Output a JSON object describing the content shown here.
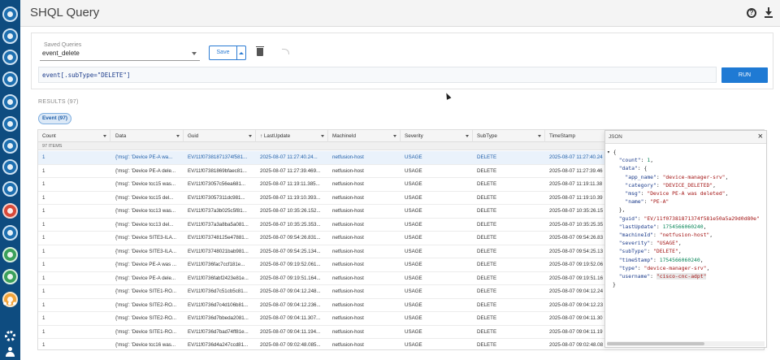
{
  "header": {
    "title": "SHQL Query"
  },
  "query_panel": {
    "saved_queries_label": "Saved Queries",
    "saved_query_value": "event_delete",
    "save_label": "Save",
    "query_text": "event[.subType=\"DELETE\"]",
    "run_label": "RUN"
  },
  "results": {
    "label": "RESULTS (97)",
    "tab_label": "Event (97)",
    "group_label": "97 ITEMS",
    "columns": [
      "Count",
      "Data",
      "Guid",
      "↑ LastUpdate",
      "MachineId",
      "Severity",
      "SubType",
      "TimeStamp"
    ],
    "rows": [
      [
        "1",
        "{'msg': 'Device PE-A wa...",
        "EV/11f07381871374f581...",
        "2025-08-07 11:27:40.24...",
        "netfusion-host",
        "USAGE",
        "DELETE",
        "2025-08-07 11:27:40.24"
      ],
      [
        "1",
        "{'msg': 'Device PE-A dele...",
        "EV/11f07381869bfaec81...",
        "2025-08-07 11:27:39.469...",
        "netfusion-host",
        "USAGE",
        "DELETE",
        "2025-08-07 11:27:39.46"
      ],
      [
        "1",
        "{'msg': 'Device tcc15 was...",
        "EV/11f073057c56ea681...",
        "2025-08-07 11:19:11.385...",
        "netfusion-host",
        "USAGE",
        "DELETE",
        "2025-08-07 11:19:11.38"
      ],
      [
        "1",
        "{'msg': 'Device tcc15 del...",
        "EV/11f073057311dc981...",
        "2025-08-07 11:19:10.393...",
        "netfusion-host",
        "USAGE",
        "DELETE",
        "2025-08-07 11:19:10.39"
      ],
      [
        "1",
        "{'msg': 'Device tcc13 was...",
        "EV/11f0737a3b025c5f81...",
        "2025-08-07 10:35:26.152...",
        "netfusion-host",
        "USAGE",
        "DELETE",
        "2025-08-07 10:35:26.15"
      ],
      [
        "1",
        "{'msg': 'Device tcc13 del...",
        "EV/11f0737a3a8ba5a081...",
        "2025-08-07 10:35:25.353...",
        "netfusion-host",
        "USAGE",
        "DELETE",
        "2025-08-07 10:35:25.35"
      ],
      [
        "1",
        "{'msg': 'Device SITE3-ILA...",
        "EV/11f073748125e47881...",
        "2025-08-07 09:54:26.831...",
        "netfusion-host",
        "USAGE",
        "DELETE",
        "2025-08-07 09:54:26.83"
      ],
      [
        "1",
        "{'msg': 'Device SITE3-ILA...",
        "EV/11f073748021bab981...",
        "2025-08-07 09:54:25.134...",
        "netfusion-host",
        "USAGE",
        "DELETE",
        "2025-08-07 09:54:25.13"
      ],
      [
        "1",
        "{'msg': 'Device PE-A was ...",
        "EV/11f0736fac7ccf181e...",
        "2025-08-07 09:19:52.061...",
        "netfusion-host",
        "USAGE",
        "DELETE",
        "2025-08-07 09:19:52.06"
      ],
      [
        "1",
        "{'msg': 'Device PE-A dele...",
        "EV/11f0736fabf2423e81e...",
        "2025-08-07 09:19:51.164...",
        "netfusion-host",
        "USAGE",
        "DELETE",
        "2025-08-07 09:19:51.16"
      ],
      [
        "1",
        "{'msg': 'Device SITE1-RO...",
        "EV/11f0736d7c51cb5c81...",
        "2025-08-07 09:04:12.248...",
        "netfusion-host",
        "USAGE",
        "DELETE",
        "2025-08-07 09:04:12.24"
      ],
      [
        "1",
        "{'msg': 'Device SITE2-RO...",
        "EV/11f0736d7c4d106b81...",
        "2025-08-07 09:04:12.236...",
        "netfusion-host",
        "USAGE",
        "DELETE",
        "2025-08-07 09:04:12.23"
      ],
      [
        "1",
        "{'msg': 'Device SITE2-RO...",
        "EV/11f0736d7bbeda2081...",
        "2025-08-07 09:04:11.307...",
        "netfusion-host",
        "USAGE",
        "DELETE",
        "2025-08-07 09:04:11.30"
      ],
      [
        "1",
        "{'msg': 'Device SITE1-RO...",
        "EV/11f0736d7bad74ff81e...",
        "2025-08-07 09:04:11.194...",
        "netfusion-host",
        "USAGE",
        "DELETE",
        "2025-08-07 09:04:11.19"
      ],
      [
        "1",
        "{'msg': 'Device tcc16 was...",
        "EV/11f0736d4a247ccd81...",
        "2025-08-07 09:02:48.085...",
        "netfusion-host",
        "USAGE",
        "DELETE",
        "2025-08-07 09:02:48.08"
      ]
    ]
  },
  "json_panel": {
    "title": "JSON",
    "close_glyph": "×",
    "lines": [
      {
        "indent": 0,
        "parts": [
          [
            "p",
            "{"
          ]
        ],
        "arrow": true
      },
      {
        "indent": 2,
        "parts": [
          [
            "k",
            "\"count\""
          ],
          [
            "p",
            ": "
          ],
          [
            "n",
            "1"
          ],
          [
            "p",
            ","
          ]
        ]
      },
      {
        "indent": 2,
        "parts": [
          [
            "k",
            "\"data\""
          ],
          [
            "p",
            ": {"
          ]
        ]
      },
      {
        "indent": 4,
        "parts": [
          [
            "k",
            "\"app_name\""
          ],
          [
            "p",
            ": "
          ],
          [
            "s",
            "\"device-manager-srv\""
          ],
          [
            "p",
            ","
          ]
        ]
      },
      {
        "indent": 4,
        "parts": [
          [
            "k",
            "\"category\""
          ],
          [
            "p",
            ": "
          ],
          [
            "s",
            "\"DEVICE_DELETED\""
          ],
          [
            "p",
            ","
          ]
        ]
      },
      {
        "indent": 4,
        "parts": [
          [
            "k",
            "\"msg\""
          ],
          [
            "p",
            ": "
          ],
          [
            "s",
            "\"Device PE-A was deleted\""
          ],
          [
            "p",
            ","
          ]
        ]
      },
      {
        "indent": 4,
        "parts": [
          [
            "k",
            "\"name\""
          ],
          [
            "p",
            ": "
          ],
          [
            "s",
            "\"PE-A\""
          ]
        ]
      },
      {
        "indent": 2,
        "parts": [
          [
            "p",
            "},"
          ]
        ]
      },
      {
        "indent": 2,
        "parts": [
          [
            "k",
            "\"guid\""
          ],
          [
            "p",
            ": "
          ],
          [
            "s",
            "\"EV/11f07381871374f581e50a5a29d0d80e\""
          ]
        ]
      },
      {
        "indent": 2,
        "parts": [
          [
            "k",
            "\"lastUpdate\""
          ],
          [
            "p",
            ": "
          ],
          [
            "n",
            "1754566060240"
          ],
          [
            "p",
            ","
          ]
        ]
      },
      {
        "indent": 2,
        "parts": [
          [
            "k",
            "\"machineId\""
          ],
          [
            "p",
            ": "
          ],
          [
            "s",
            "\"netfusion-host\""
          ],
          [
            "p",
            ","
          ]
        ]
      },
      {
        "indent": 2,
        "parts": [
          [
            "k",
            "\"severity\""
          ],
          [
            "p",
            ": "
          ],
          [
            "s",
            "\"USAGE\""
          ],
          [
            "p",
            ","
          ]
        ]
      },
      {
        "indent": 2,
        "parts": [
          [
            "k",
            "\"subType\""
          ],
          [
            "p",
            ": "
          ],
          [
            "s",
            "\"DELETE\""
          ],
          [
            "p",
            ","
          ]
        ]
      },
      {
        "indent": 2,
        "parts": [
          [
            "k",
            "\"timeStamp\""
          ],
          [
            "p",
            ": "
          ],
          [
            "n",
            "1754566060240"
          ],
          [
            "p",
            ","
          ]
        ]
      },
      {
        "indent": 2,
        "parts": [
          [
            "k",
            "\"type\""
          ],
          [
            "p",
            ": "
          ],
          [
            "s",
            "\"device-manager-srv\""
          ],
          [
            "p",
            ","
          ]
        ]
      },
      {
        "indent": 2,
        "parts": [
          [
            "k",
            "\"username\""
          ],
          [
            "p",
            ": "
          ],
          [
            "h",
            "\"cisco-cnc-adpt\""
          ]
        ]
      },
      {
        "indent": 0,
        "parts": [
          [
            "p",
            "}"
          ]
        ]
      }
    ]
  },
  "nav_rail": {
    "items": [
      "globe-icon",
      "network-icon",
      "device-icon",
      "inventory-icon",
      "document-icon",
      "topology-icon",
      "service-icon",
      "monitor-icon",
      "analytics-icon",
      "alarm-icon",
      "security-icon",
      "dashboard-icon",
      "warning-icon",
      "jobs-icon",
      "more-icon",
      "settings-icon",
      "user-icon"
    ],
    "more_glyph": "•••"
  },
  "colors": {
    "rail": "#0e4c80",
    "accent": "#1f7ad4",
    "selected_row": "#eaf2fb"
  }
}
